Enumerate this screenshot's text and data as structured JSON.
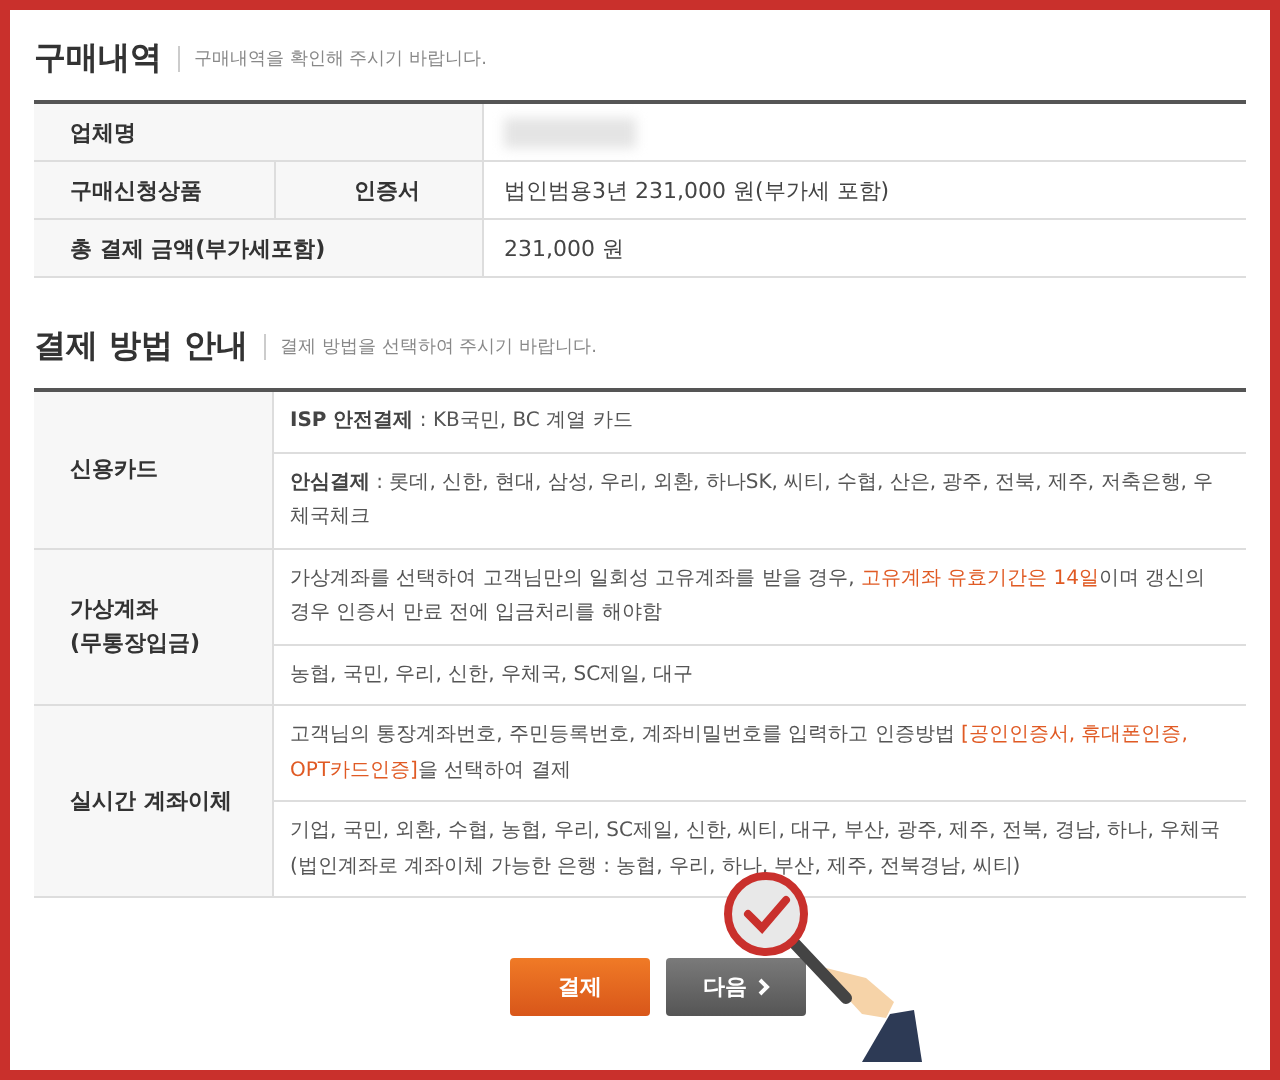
{
  "purchase": {
    "title": "구매내역",
    "subtitle": "구매내역을 확인해 주시기 바랍니다.",
    "rows": [
      {
        "label": "업체명",
        "value": "",
        "redacted": true
      },
      {
        "label": "구매신청상품",
        "sublabel": "인증서",
        "value": "법인범용3년 231,000 원(부가세 포함)",
        "redacted": false
      },
      {
        "label": "총 결제 금액(부가세포함)",
        "value": "231,000 원",
        "redacted": false
      }
    ]
  },
  "payment": {
    "title": "결제 방법 안내",
    "subtitle": "결제 방법을 선택하여 주시기 바랍니다.",
    "methods": [
      {
        "label": [
          "신용카드"
        ],
        "items": [
          {
            "segments": [
              {
                "text": "**ISP 안전결제** : KB국민, BC 계열 카드",
                "highlight": false
              }
            ]
          },
          {
            "segments": [
              {
                "text": "**안심결제** : 롯데, 신한, 현대, 삼성, 우리, 외환, 하나SK, 씨티, 수협, 산은, 광주, 전북, 제주, 저축은행, 우체국체크",
                "highlight": false
              }
            ]
          }
        ]
      },
      {
        "label": [
          "가상계좌",
          "(무통장입금)"
        ],
        "items": [
          {
            "segments": [
              {
                "text": "가상계좌를 선택하여 고객님만의 일회성 고유계좌를 받을 경우, ",
                "highlight": false
              },
              {
                "text": "고유계좌 유효기간은 14일",
                "highlight": true
              },
              {
                "text": "이며 갱신의 경우 인증서 만료 전에 입금처리를 해야함",
                "highlight": false
              }
            ]
          },
          {
            "segments": [
              {
                "text": "농협, 국민, 우리, 신한, 우체국, SC제일, 대구",
                "highlight": false
              }
            ]
          }
        ]
      },
      {
        "label": [
          "실시간 계좌이체"
        ],
        "items": [
          {
            "segments": [
              {
                "text": "고객님의 통장계좌번호, 주민등록번호, 계좌비밀번호를 입력하고 인증방법 ",
                "highlight": false
              },
              {
                "text": "[공인인증서, 휴대폰인증, OPT카드인증]",
                "highlight": true
              },
              {
                "text": "을 선택하여 결제",
                "highlight": false
              }
            ]
          },
          {
            "segments": [
              {
                "text": "기업, 국민, 외환, 수협, 농협, 우리, SC제일, 신한, 씨티, 대구, 부산, 광주, 제주, 전북, 경남, 하나, 우체국 (법인계좌로 계좌이체 가능한 은행 : 농협, 우리, 하나, 부산, 제주, 전북경남, 씨티)",
                "highlight": false
              }
            ]
          }
        ]
      }
    ]
  },
  "buttons": [
    {
      "label": "결제",
      "kind": "primary"
    },
    {
      "label": "다음",
      "kind": "secondary"
    }
  ]
}
